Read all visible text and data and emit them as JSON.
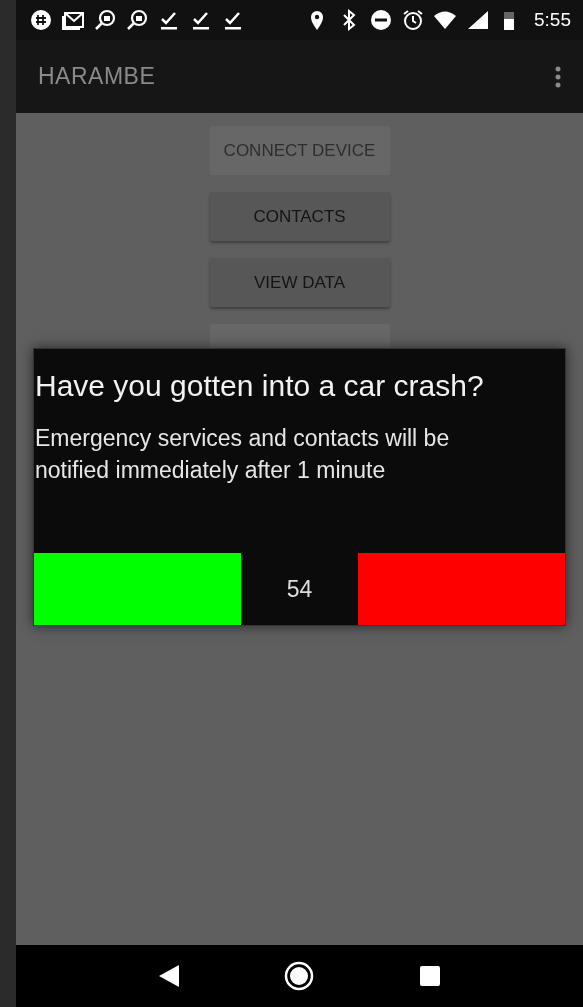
{
  "status_bar": {
    "time": "5:55"
  },
  "app_bar": {
    "title": "HARAMBE"
  },
  "buttons": [
    {
      "label": "CONNECT DEVICE",
      "disabled": true
    },
    {
      "label": "CONTACTS",
      "disabled": false
    },
    {
      "label": "VIEW DATA",
      "disabled": false
    },
    {
      "disabled": true
    }
  ],
  "dialog": {
    "title": "Have you gotten into a car crash?",
    "message": "Emergency services and contacts will be notified immediately after 1 minute",
    "countdown": "54",
    "actions": [
      {
        "color": "#00ff00"
      },
      {
        "color": "#ff0000"
      }
    ]
  }
}
